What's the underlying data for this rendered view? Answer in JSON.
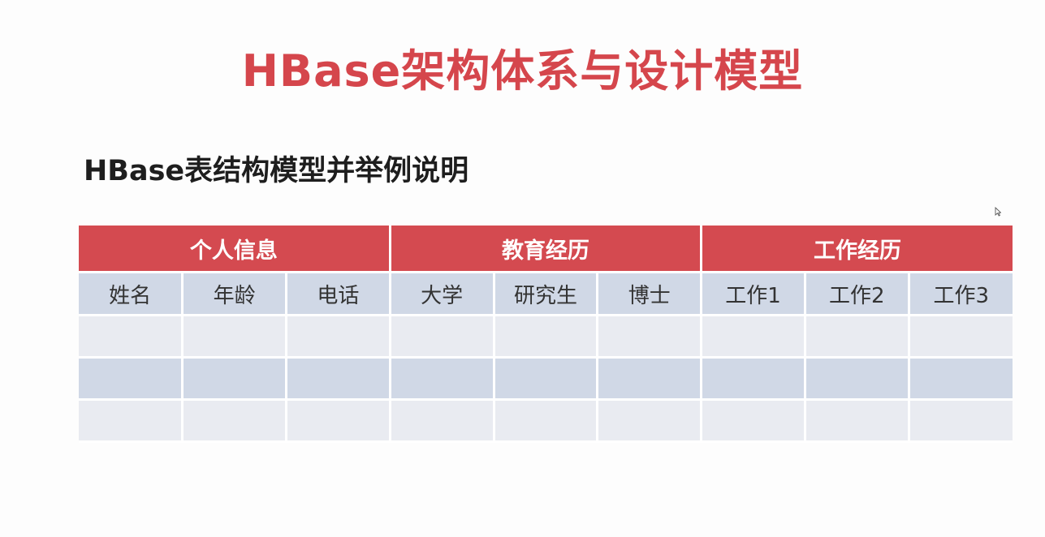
{
  "slide": {
    "title": "HBase架构体系与设计模型",
    "subtitle": "HBase表结构模型并举例说明"
  },
  "table": {
    "groups": [
      {
        "label": "个人信息",
        "columns": [
          "姓名",
          "年龄",
          "电话"
        ]
      },
      {
        "label": "教育经历",
        "columns": [
          "大学",
          "研究生",
          "博士"
        ]
      },
      {
        "label": "工作经历",
        "columns": [
          "工作1",
          "工作2",
          "工作3"
        ]
      }
    ],
    "empty_row_count_visible": 3
  },
  "colors": {
    "title": "#d5464c",
    "group_header_bg": "#d44a50",
    "column_header_bg": "#d0d8e6",
    "row_light_bg": "#e9ebf1",
    "row_dark_bg": "#d0d8e6"
  },
  "icons": {
    "cursor": "mouse-pointer-icon"
  }
}
